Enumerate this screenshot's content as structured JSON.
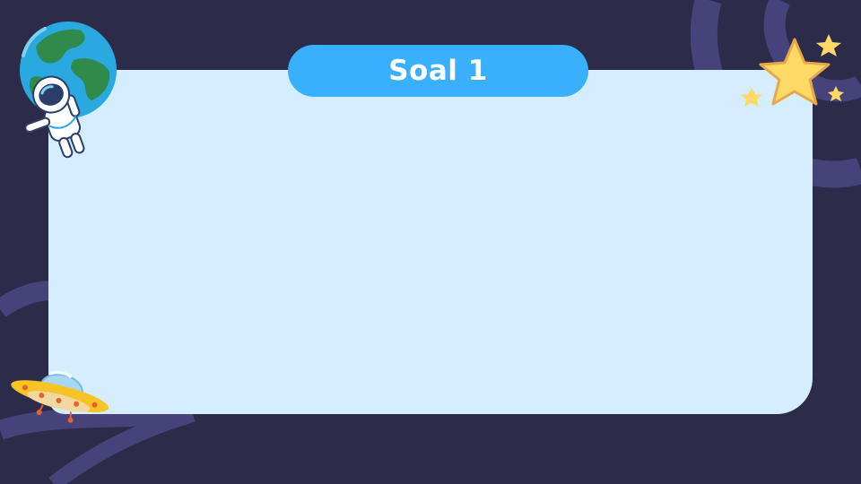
{
  "slide": {
    "title": "Soal 1"
  },
  "decorations": {
    "earth": "earth-illustration",
    "astronaut": "astronaut-illustration",
    "stars": "stars-illustration",
    "ufo": "ufo-illustration"
  },
  "colors": {
    "background": "#2c2b4a",
    "swirl": "#46437a",
    "card": "#d4eeff",
    "title_pill": "#3aaffb",
    "title_text": "#ffffff",
    "star": "#ffd966"
  }
}
